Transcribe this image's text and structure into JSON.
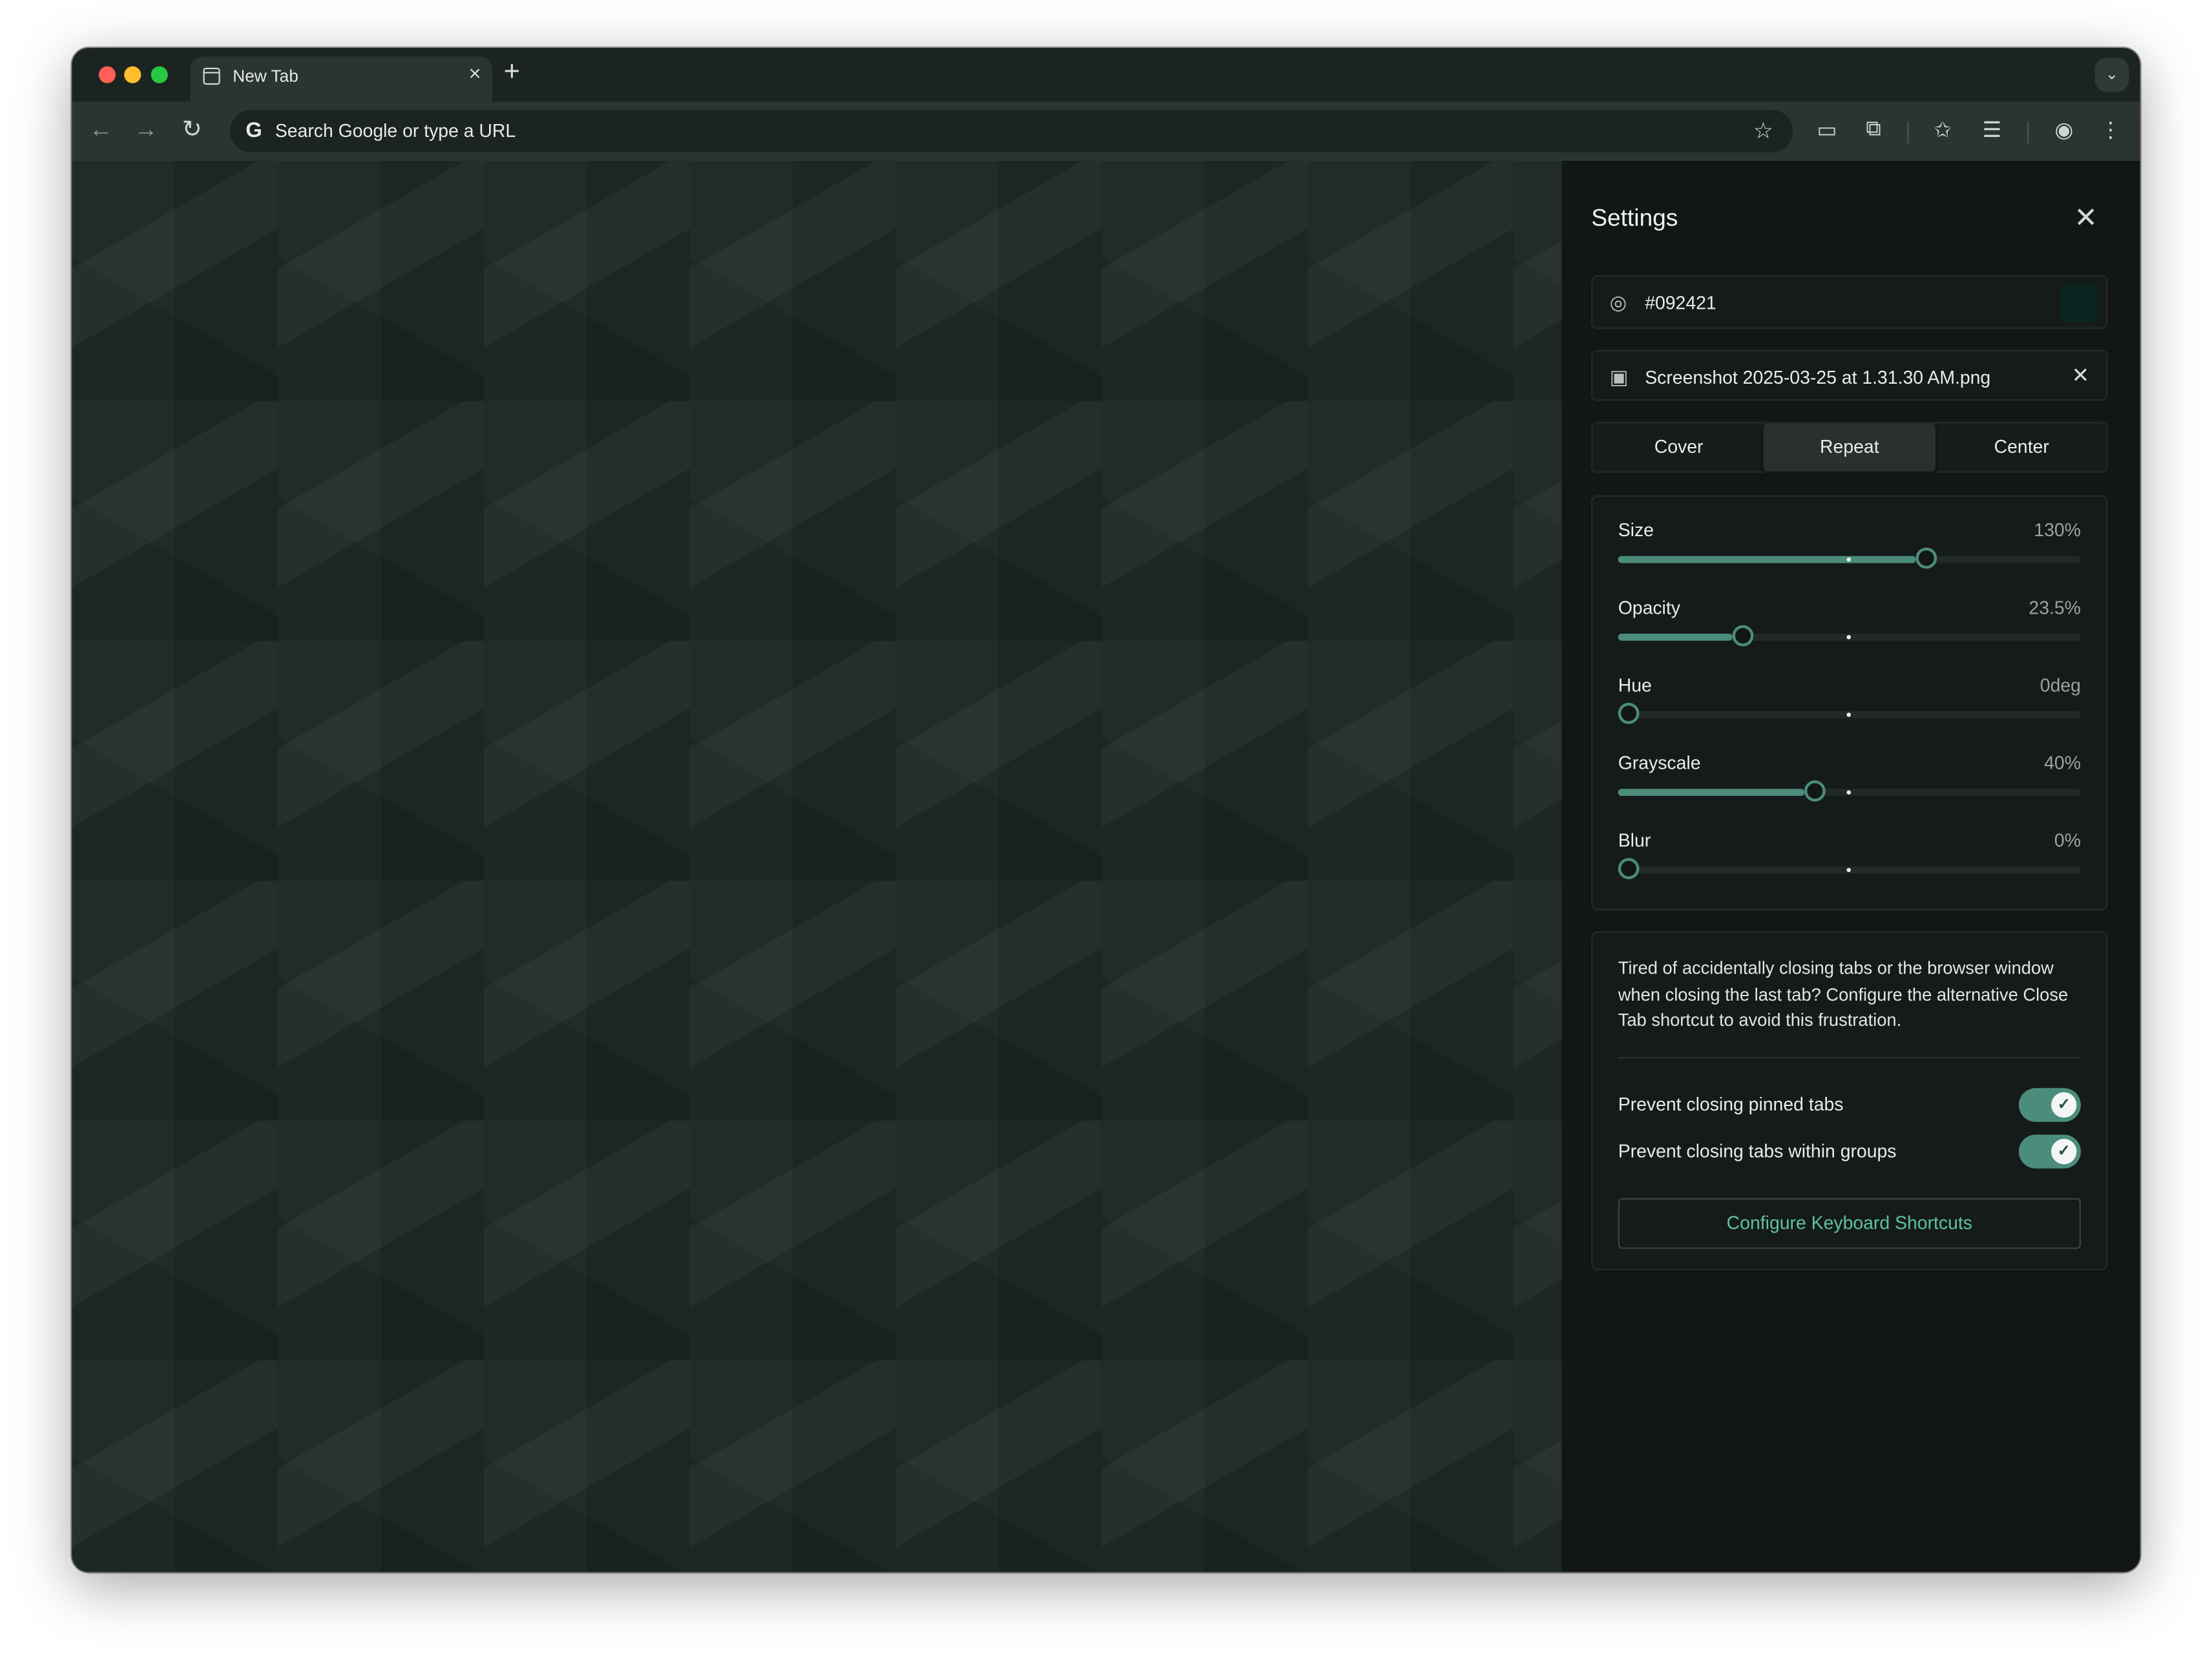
{
  "browser": {
    "tab_title": "New Tab",
    "tab_close": "×",
    "new_tab": "+",
    "tab_search": "⌄",
    "omnibox_placeholder": "Search Google or type a URL"
  },
  "settings": {
    "title": "Settings",
    "close": "✕",
    "color_value": "#092421",
    "file_name": "Screenshot 2025-03-25 at 1.31.30 AM.png",
    "file_remove": "✕",
    "fit_options": [
      "Cover",
      "Repeat",
      "Center"
    ],
    "fit_selected": "Repeat",
    "sliders": [
      {
        "label": "Size",
        "value": "130%",
        "level": 0.643
      },
      {
        "label": "Opacity",
        "value": "23.5%",
        "level": 0.247
      },
      {
        "label": "Hue",
        "value": "0deg",
        "level": 0.0
      },
      {
        "label": "Grayscale",
        "value": "40%",
        "level": 0.403
      },
      {
        "label": "Blur",
        "value": "0%",
        "level": 0.0
      }
    ],
    "info_text": "Tired of accidentally closing tabs or the browser window when closing the last tab? Configure the alternative Close Tab shortcut to avoid this frustration.",
    "toggles": [
      {
        "label": "Prevent closing pinned tabs",
        "on": true
      },
      {
        "label": "Prevent closing tabs within groups",
        "on": true
      }
    ],
    "configure_button": "Configure Keyboard Shortcuts"
  },
  "colors": {
    "accent": "#4c8c7c",
    "accent_text": "#5fc1a6",
    "swatch": "#092421",
    "panel_bg": "#121715"
  }
}
